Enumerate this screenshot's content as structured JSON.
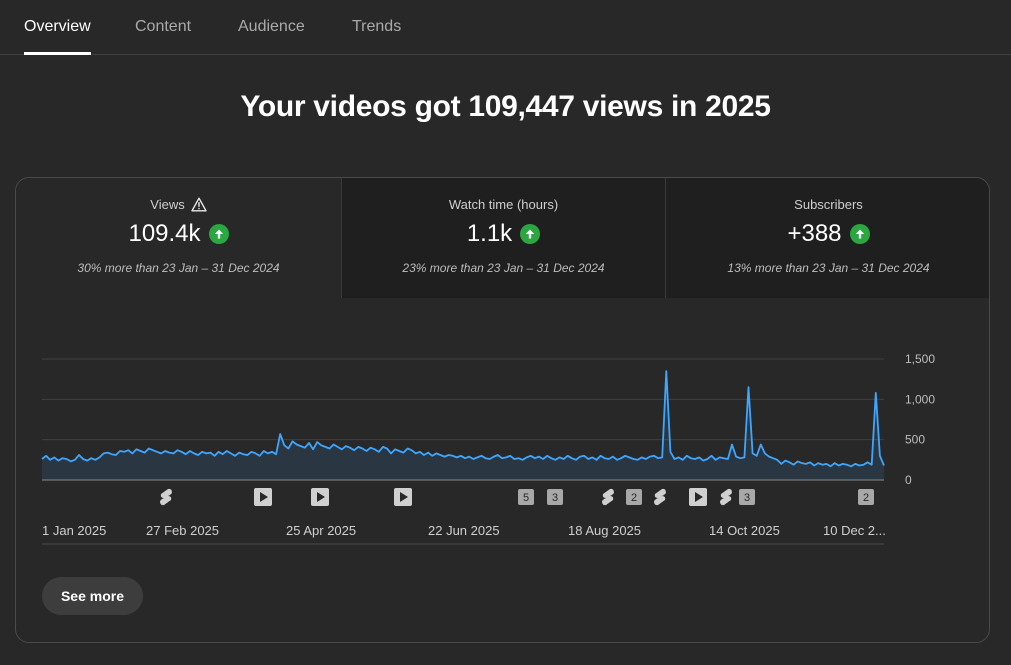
{
  "tabs": [
    {
      "label": "Overview",
      "active": true
    },
    {
      "label": "Content",
      "active": false
    },
    {
      "label": "Audience",
      "active": false
    },
    {
      "label": "Trends",
      "active": false
    }
  ],
  "headline": "Your videos got 109,447 views in 2025",
  "metrics": [
    {
      "label": "Views",
      "value": "109.4k",
      "compare": "30% more than 23 Jan – 31 Dec 2024",
      "warning_icon": "warning-icon",
      "trend_icon": "arrow-up-icon"
    },
    {
      "label": "Watch time (hours)",
      "value": "1.1k",
      "compare": "23% more than 23 Jan – 31 Dec 2024",
      "trend_icon": "arrow-up-icon"
    },
    {
      "label": "Subscribers",
      "value": "+388",
      "compare": "13% more than 23 Jan – 31 Dec 2024",
      "trend_icon": "arrow-up-icon"
    }
  ],
  "colors": {
    "line": "#3ea6ff",
    "trend_up": "#2ba640"
  },
  "chart_data": {
    "type": "line",
    "x_start": "1 Jan 2025",
    "x_ticks": [
      "1 Jan 2025",
      "27 Feb 2025",
      "25 Apr 2025",
      "22 Jun 2025",
      "18 Aug 2025",
      "14 Oct 2025",
      "10 Dec 2..."
    ],
    "y_ticks": [
      "1,500",
      "1,000",
      "500",
      "0"
    ],
    "ylim": [
      0,
      1500
    ],
    "grid": true,
    "series": [
      {
        "values": [
          260,
          300,
          250,
          280,
          240,
          270,
          260,
          230,
          250,
          310,
          260,
          240,
          270,
          250,
          280,
          330,
          340,
          320,
          310,
          360,
          350,
          370,
          330,
          380,
          360,
          340,
          390,
          370,
          350,
          330,
          360,
          340,
          330,
          370,
          350,
          320,
          360,
          330,
          310,
          350,
          330,
          340,
          300,
          350,
          320,
          360,
          330,
          300,
          340,
          320,
          310,
          350,
          330,
          300,
          360,
          330,
          350,
          320,
          570,
          430,
          390,
          480,
          440,
          420,
          400,
          460,
          380,
          470,
          430,
          410,
          390,
          440,
          410,
          380,
          420,
          400,
          370,
          410,
          390,
          360,
          400,
          380,
          350,
          410,
          390,
          330,
          380,
          360,
          340,
          390,
          370,
          330,
          350,
          310,
          340,
          300,
          330,
          310,
          290,
          310,
          300,
          280,
          300,
          270,
          290,
          260,
          280,
          300,
          270,
          260,
          290,
          310,
          270,
          280,
          300,
          260,
          270,
          250,
          280,
          300,
          270,
          290,
          260,
          300,
          270,
          250,
          280,
          260,
          300,
          270,
          250,
          290,
          300,
          260,
          280,
          250,
          300,
          270,
          260,
          290,
          250,
          270,
          300,
          280,
          260,
          250,
          280,
          260,
          290,
          300,
          270,
          280,
          1350,
          350,
          260,
          280,
          250,
          300,
          270,
          260,
          280,
          240,
          260,
          300,
          250,
          280,
          270,
          260,
          440,
          290,
          270,
          280,
          1150,
          330,
          300,
          440,
          330,
          290,
          270,
          250,
          200,
          240,
          220,
          190,
          230,
          210,
          200,
          220,
          180,
          210,
          190,
          200,
          170,
          210,
          180,
          200,
          190,
          170,
          200,
          180,
          190,
          220,
          190,
          1080,
          300,
          180
        ]
      }
    ],
    "event_markers": [
      {
        "type": "short",
        "label": ""
      },
      {
        "type": "video",
        "label": ""
      },
      {
        "type": "video",
        "label": ""
      },
      {
        "type": "video",
        "label": ""
      },
      {
        "type": "count",
        "label": "5"
      },
      {
        "type": "count",
        "label": "3"
      },
      {
        "type": "short",
        "label": ""
      },
      {
        "type": "count",
        "label": "2"
      },
      {
        "type": "short",
        "label": ""
      },
      {
        "type": "video",
        "label": ""
      },
      {
        "type": "short",
        "label": ""
      },
      {
        "type": "count",
        "label": "3"
      },
      {
        "type": "count",
        "label": "2"
      }
    ]
  },
  "see_more_label": "See more"
}
